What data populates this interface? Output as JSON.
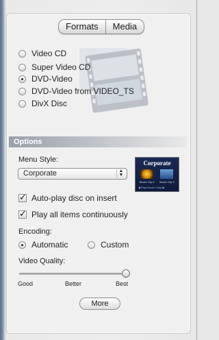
{
  "tabs": [
    {
      "label": "Formats"
    },
    {
      "label": "Media"
    }
  ],
  "formats": [
    {
      "label": "Video CD",
      "selected": false
    },
    {
      "label": "Super Video CD",
      "selected": false
    },
    {
      "label": "DVD-Video",
      "selected": true
    },
    {
      "label": "DVD-Video from VIDEO_TS",
      "selected": false
    },
    {
      "label": "DivX Disc",
      "selected": false
    }
  ],
  "options": {
    "header": "Options",
    "menu_style_label": "Menu Style:",
    "menu_style_value": "Corporate",
    "preview": {
      "title": "Corporate",
      "clip1": "Movie Clip 1",
      "clip2": "Movie Clip 2",
      "nav": "◀  Play    Movie    Chap  ▶"
    },
    "autoplay_label": "Auto-play disc on insert",
    "autoplay_checked": true,
    "playall_label": "Play all items continuously",
    "playall_checked": true,
    "encoding_label": "Encoding:",
    "encoding_automatic": "Automatic",
    "encoding_custom": "Custom",
    "encoding_selected": "Automatic",
    "quality_label": "Video Quality:",
    "quality_ticks": [
      "Good",
      "Better",
      "Best"
    ],
    "quality_value": 1.0,
    "more_button": "More"
  }
}
